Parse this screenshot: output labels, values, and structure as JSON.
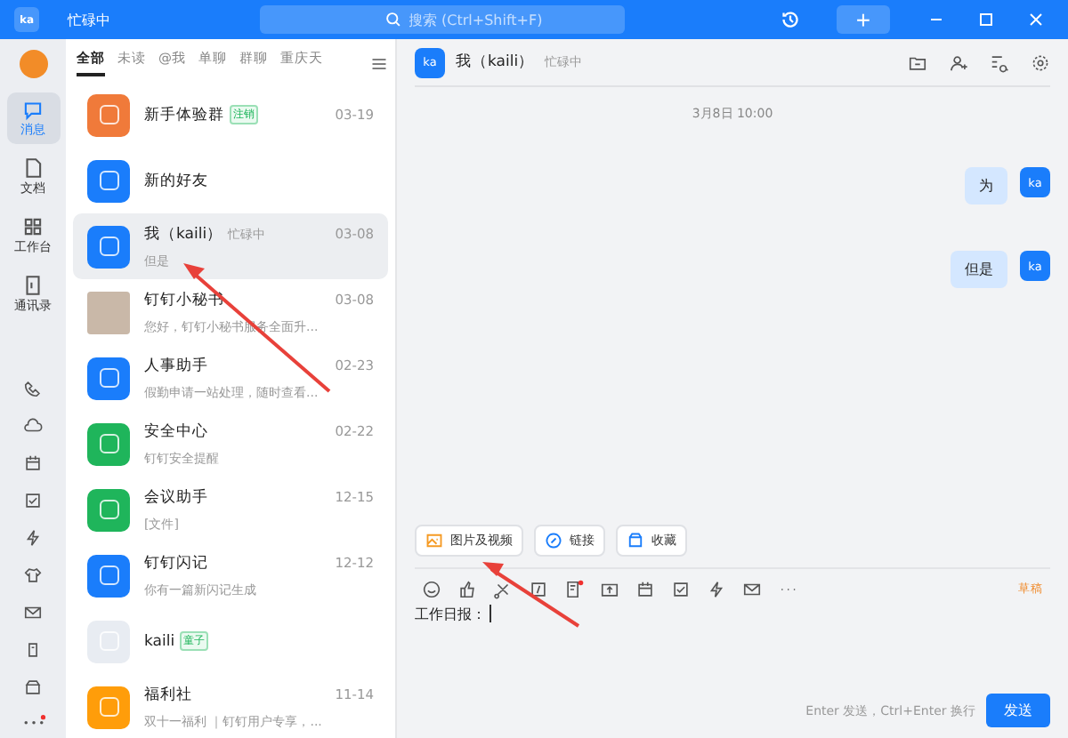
{
  "title_bar": {
    "logo": "ka",
    "status": "忙碌中",
    "search": {
      "placeholder": "搜索 (Ctrl+Shift+F)"
    },
    "add_button": "+"
  },
  "nav_rail": {
    "items": [
      {
        "label": "消息",
        "selected": true
      },
      {
        "label": "文档",
        "selected": false
      },
      {
        "label": "工作台",
        "selected": false
      },
      {
        "label": "通讯录",
        "selected": false
      }
    ],
    "more_has_dot": true
  },
  "conversation_list": {
    "tabs": [
      {
        "label": "全部",
        "selected": true
      },
      {
        "label": "未读",
        "selected": false
      },
      {
        "label": "@我",
        "selected": false
      },
      {
        "label": "单聊",
        "selected": false
      },
      {
        "label": "群聊",
        "selected": false
      },
      {
        "label": "重庆天",
        "selected": false
      }
    ],
    "items": [
      {
        "name": "新手体验群",
        "tag": "注销",
        "time": "03-19",
        "kind": "icon",
        "color": "#f07a3a",
        "selected": false
      },
      {
        "name": "新的好友",
        "kind": "icon",
        "color": "#1a7dfb",
        "selected": false
      },
      {
        "name": "我（kaili）",
        "status": "忙碌中",
        "time": "03-08",
        "preview": "但是",
        "kind": "icon",
        "color": "#1a7dfb",
        "selected": true
      },
      {
        "name": "钉钉小秘书",
        "time": "03-08",
        "preview": "您好，钉钉小秘书服务全面升...",
        "kind": "photo",
        "color": "#c9b8a8",
        "selected": false
      },
      {
        "name": "人事助手",
        "time": "02-23",
        "preview": "假勤申请一站处理，随时查看...",
        "kind": "icon",
        "color": "#1a7dfb",
        "selected": false
      },
      {
        "name": "安全中心",
        "time": "02-22",
        "preview": "钉钉安全提醒",
        "kind": "icon",
        "color": "#1fb55b",
        "selected": false
      },
      {
        "name": "会议助手",
        "time": "12-15",
        "preview": "[文件]",
        "kind": "icon",
        "color": "#1fb55b",
        "selected": false
      },
      {
        "name": "钉钉闪记",
        "time": "12-12",
        "preview": "你有一篇新闪记生成",
        "kind": "icon",
        "color": "#1a7dfb",
        "selected": false
      },
      {
        "name": "kaili",
        "tag": "童子",
        "kind": "icon",
        "color": "#e8ecf2",
        "selected": false
      },
      {
        "name": "福利社",
        "time": "11-14",
        "preview": "双十一福利 ｜钉钉用户专享，...",
        "kind": "icon",
        "color": "#ff9d0a",
        "selected": false
      }
    ]
  },
  "chat": {
    "avatar": "ka",
    "title": "我（kaili）",
    "status": "忙碌中",
    "date": "3月8日 10:00",
    "messages": [
      {
        "text": "为",
        "avatar": "ka"
      },
      {
        "text": "但是",
        "avatar": "ka"
      }
    ],
    "quick_actions": [
      "图片及视频",
      "链接",
      "收藏"
    ],
    "toolbar": [
      {
        "dot": false
      },
      {
        "dot": false
      },
      {
        "dot": false
      },
      {
        "dot": false
      },
      {
        "dot": true
      },
      {
        "dot": false
      },
      {
        "dot": false
      },
      {
        "dot": false
      },
      {
        "dot": false
      },
      {
        "dot": false
      },
      {
        "dot": false
      }
    ],
    "draft_label": "草稿",
    "input": {
      "value": "工作日报："
    },
    "hint": "Enter 发送，Ctrl+Enter 换行",
    "send_button": "发送"
  }
}
